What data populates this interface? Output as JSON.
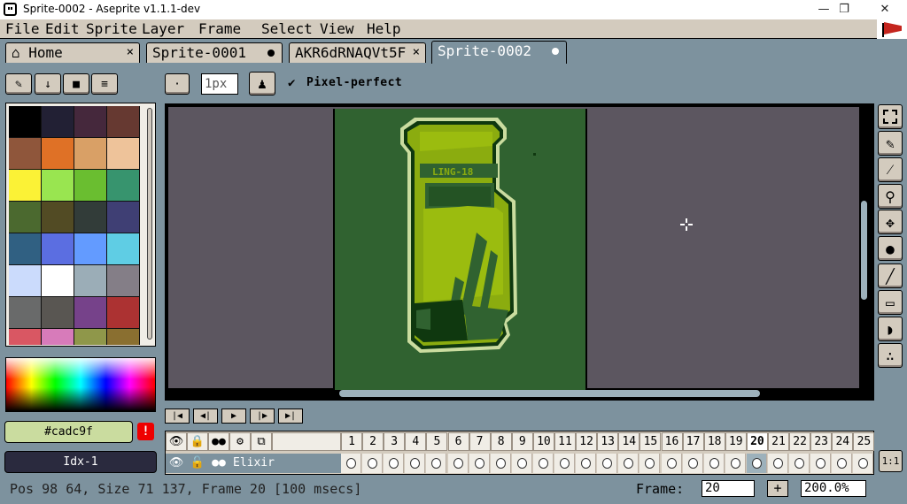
{
  "window": {
    "title": "Sprite-0002 - Aseprite v1.1.1-dev",
    "minimize": "—",
    "maximize": "❐",
    "close": "✕"
  },
  "menu": [
    "File",
    "Edit",
    "Sprite",
    "Layer",
    "Frame",
    "Select",
    "View",
    "Help"
  ],
  "tabs": [
    {
      "label": "Home",
      "closer": "×"
    },
    {
      "label": "Sprite-0001"
    },
    {
      "label": "AKR6dRNAQVt5F",
      "closer": "×"
    },
    {
      "label": "Sprite-0002"
    }
  ],
  "context_bar": {
    "brush_size": "1px",
    "pixel_perfect_check": "✔",
    "pixel_perfect_label": "Pixel-perfect"
  },
  "palette_colors": [
    "#000000",
    "#222034",
    "#45283c",
    "#663931",
    "#8f563b",
    "#df7126",
    "#d9a066",
    "#eec39a",
    "#fbf236",
    "#99e550",
    "#6abe30",
    "#37946e",
    "#4b692f",
    "#524b24",
    "#323c39",
    "#3f3f74",
    "#306082",
    "#5b6ee1",
    "#639bff",
    "#5fcde4",
    "#cbdbfc",
    "#ffffff",
    "#9badb7",
    "#847e87",
    "#696a6a",
    "#595652",
    "#76428a",
    "#ac3232",
    "#d95763",
    "#d77bba",
    "#8f974a",
    "#8a6f30"
  ],
  "colors": {
    "foreground": "#cadc9f",
    "foreground_label": "#cadc9f",
    "background_label": "Idx-1",
    "warning": "!"
  },
  "sprite_text": "LING-18",
  "timeline": {
    "layer_name": "Elixir",
    "frames": [
      "1",
      "2",
      "3",
      "4",
      "5",
      "6",
      "7",
      "8",
      "9",
      "10",
      "11",
      "12",
      "13",
      "14",
      "15",
      "16",
      "17",
      "18",
      "19",
      "20",
      "21",
      "22",
      "23",
      "24",
      "25"
    ],
    "current_frame": 20,
    "zoom_button": "1:1"
  },
  "status": {
    "text": "Pos 98 64, Size 71 137, Frame 20 [100 msecs]",
    "frame_label": "Frame:",
    "frame_value": "20",
    "plus": "+",
    "zoom_value": "200.0%"
  }
}
